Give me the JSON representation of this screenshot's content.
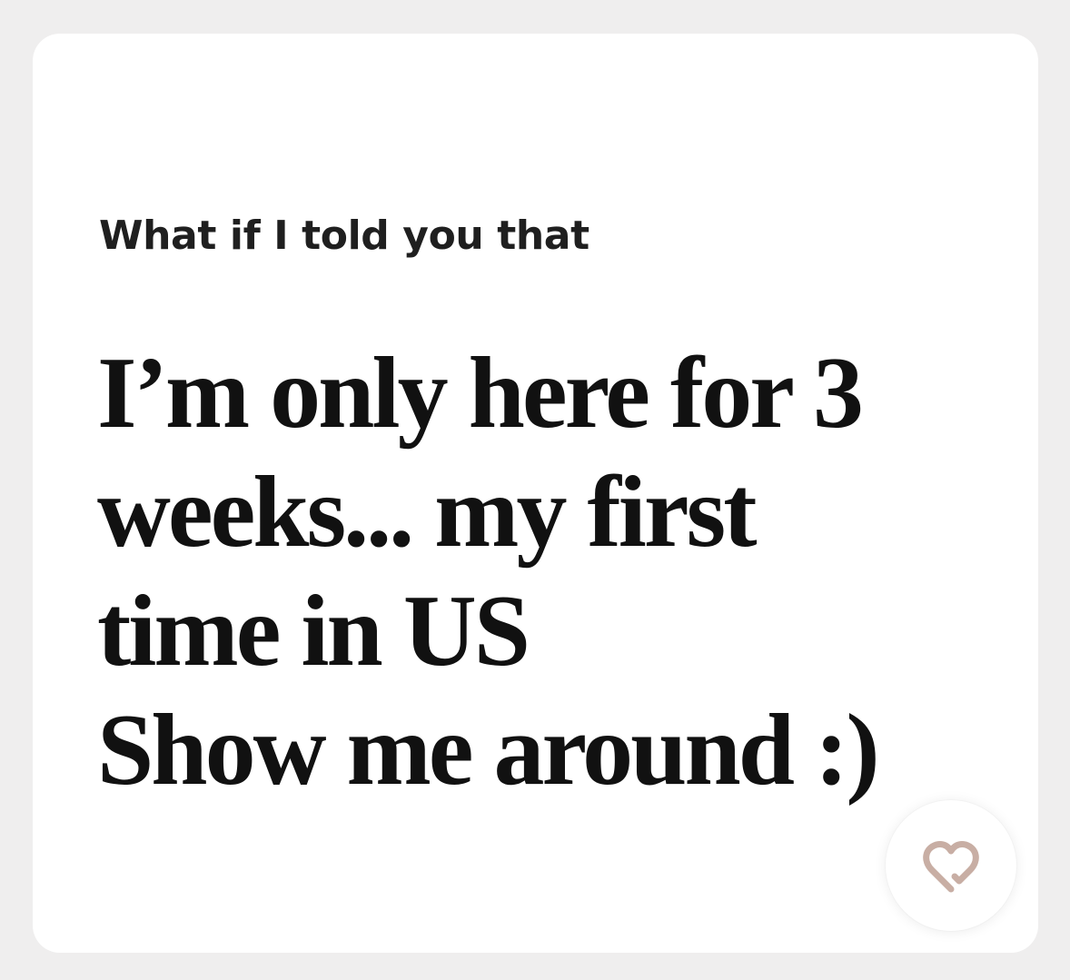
{
  "prompt": {
    "label": "What if I told you that"
  },
  "answer": {
    "lines": [
      "I’m only here for 3",
      "weeks... my first",
      "time in US",
      "Show me around :)"
    ]
  },
  "like_button": {
    "icon": "heart-icon",
    "icon_color": "#c8aea4"
  },
  "colors": {
    "background": "#efeeee",
    "card": "#ffffff",
    "text": "#111111"
  }
}
